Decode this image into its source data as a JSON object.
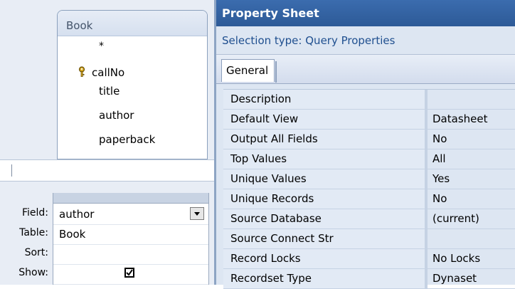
{
  "query_design": {
    "table": {
      "title": "Book",
      "fields": [
        {
          "name": "*",
          "primary_key": false
        },
        {
          "name": "callNo",
          "primary_key": true,
          "icon": "key-icon"
        },
        {
          "name": "title",
          "primary_key": false
        },
        {
          "name": "author",
          "primary_key": false
        },
        {
          "name": "paperback",
          "primary_key": false
        }
      ]
    },
    "grid": {
      "row_labels": {
        "field": "Field:",
        "table": "Table:",
        "sort": "Sort:",
        "show": "Show:"
      },
      "column": {
        "field": "author",
        "table": "Book",
        "sort": "",
        "show": true
      }
    }
  },
  "property_sheet": {
    "title": "Property Sheet",
    "selection_label": "Selection type:",
    "selection_value": "Query Properties",
    "tabs": [
      "General"
    ],
    "properties": [
      {
        "name": "Description",
        "value": ""
      },
      {
        "name": "Default View",
        "value": "Datasheet"
      },
      {
        "name": "Output All Fields",
        "value": "No"
      },
      {
        "name": "Top Values",
        "value": "All"
      },
      {
        "name": "Unique Values",
        "value": "Yes"
      },
      {
        "name": "Unique Records",
        "value": "No"
      },
      {
        "name": "Source Database",
        "value": "(current)"
      },
      {
        "name": "Source Connect Str",
        "value": ""
      },
      {
        "name": "Record Locks",
        "value": "No Locks"
      },
      {
        "name": "Recordset Type",
        "value": "Dynaset"
      }
    ]
  },
  "colors": {
    "title_bar": "#2d5a97",
    "sheet_bg": "#dde6f2",
    "property_name_bg": "#e2eaf5"
  }
}
